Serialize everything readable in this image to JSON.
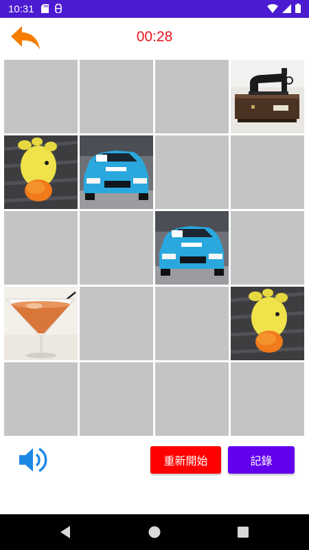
{
  "status_bar": {
    "time": "10:31",
    "icons": [
      "sd-card-icon",
      "android-debug-icon",
      "wifi-icon",
      "signal-icon",
      "battery-icon"
    ]
  },
  "header": {
    "timer": "00:28",
    "back_icon": "back-arrow-icon"
  },
  "board": {
    "rows": 5,
    "cols": 4,
    "tiles": [
      "hidden",
      "hidden",
      "hidden",
      "sewing-machine",
      "duck-toy",
      "race-car",
      "hidden",
      "hidden",
      "hidden",
      "hidden",
      "race-car",
      "hidden",
      "cocktail",
      "hidden",
      "hidden",
      "duck-toy",
      "hidden",
      "hidden",
      "hidden",
      "hidden"
    ]
  },
  "controls": {
    "sound_icon": "speaker-icon",
    "restart_label": "重新開始",
    "record_label": "記錄"
  },
  "colors": {
    "status_bar": "#4a1bd0",
    "timer": "#e8151b",
    "back_arrow": "#f57c00",
    "hidden_tile": "#c4c4c4",
    "restart_button": "#ff0000",
    "record_button": "#6200ee",
    "sound_icon": "#1e88e5"
  },
  "nav_bar": {
    "icons": [
      "back-triangle-icon",
      "home-circle-icon",
      "recents-square-icon"
    ]
  }
}
